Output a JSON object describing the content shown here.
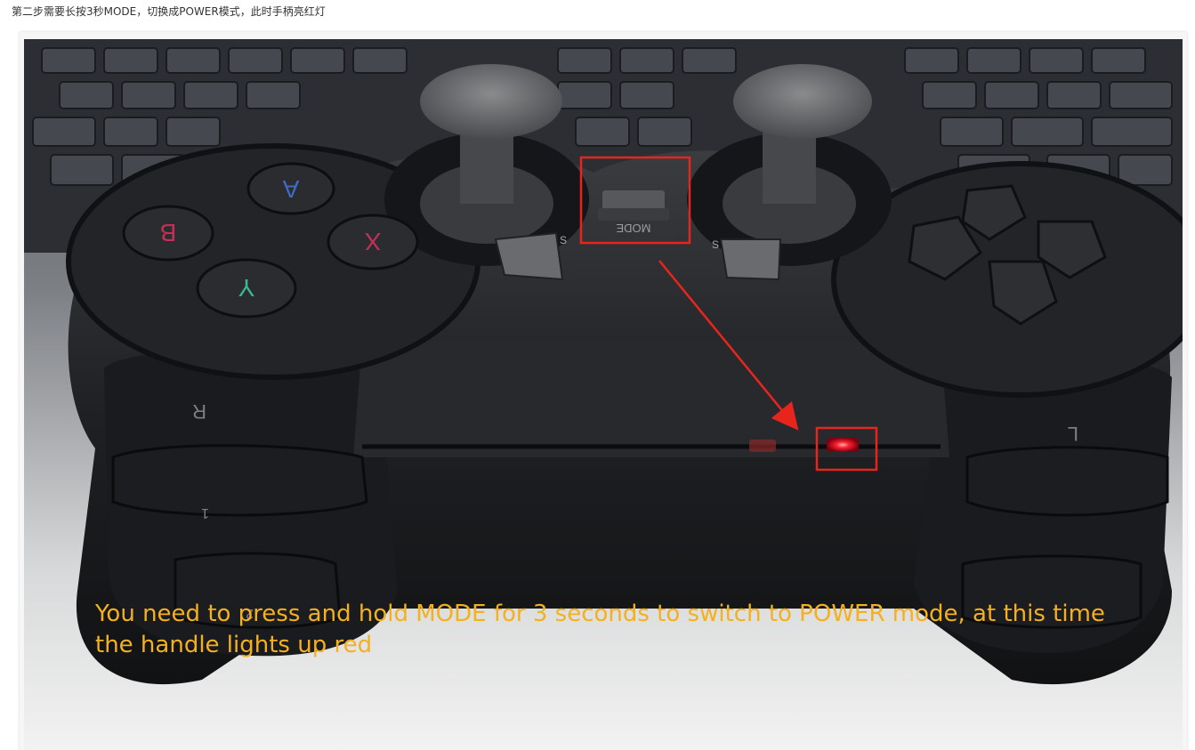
{
  "article": {
    "step_text": "第二步需要长按3秒MODE，切换成POWER模式，此时手柄亮红灯"
  },
  "photo": {
    "caption": "You need to press and hold MODE for 3 seconds to switch to POWER mode, at this time the handle lights up red",
    "caption_color": "#f5b020",
    "highlight_color": "#e8251c",
    "led_color": "#ff2030",
    "face_buttons": {
      "top": "A",
      "left": "B",
      "right": "X",
      "bottom": "Y"
    },
    "mode_label": "MODE",
    "select_mark": "S",
    "start_mark": "S",
    "right_shoulder": "R",
    "left_shoulder": "L",
    "r1": "1",
    "r2": "2",
    "icons": [
      "mode-button",
      "power-led",
      "arrow"
    ]
  }
}
